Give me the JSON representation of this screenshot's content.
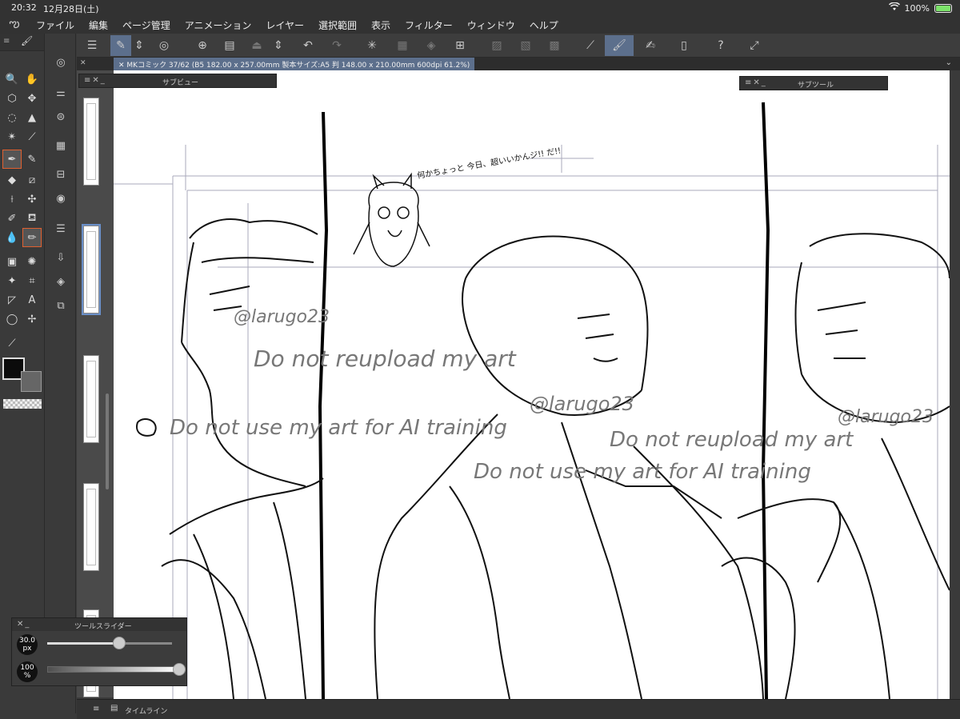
{
  "status": {
    "time": "20:32",
    "date": "12月28日(土)",
    "battery": "100%"
  },
  "menu": {
    "logo": "ఌ",
    "items": [
      "ファイル",
      "編集",
      "ページ管理",
      "アニメーション",
      "レイヤー",
      "選択範囲",
      "表示",
      "フィルター",
      "ウィンドウ",
      "ヘルプ"
    ]
  },
  "document": {
    "tab_label": "MKコミック 37/62 (B5 182.00 x 257.00mm 製本サイズ:A5 判 148.00 x 210.00mm 600dpi 61.2%)"
  },
  "palettes": {
    "subview": "サブビュー",
    "subtool": "サブツール",
    "tool_slider": "ツールスライダー",
    "timeline": "タイムライン"
  },
  "tool_slider": {
    "brush_size": "30.0",
    "brush_size_unit": "px",
    "opacity": "100",
    "opacity_unit": "%",
    "brush_size_fraction": 0.58,
    "opacity_fraction": 1.0
  },
  "canvas_text": {
    "watermark_handle": "@larugo23",
    "watermark_1": "Do not reupload my art",
    "watermark_2": "Do not use my art for AI training",
    "speech_note": "何かちょっと 今日、超いいかんジ!! だ!!"
  },
  "colors": {
    "accent": "#5c6f8c",
    "active_tool": "#e06030",
    "main_color": "#0b0b0b"
  }
}
